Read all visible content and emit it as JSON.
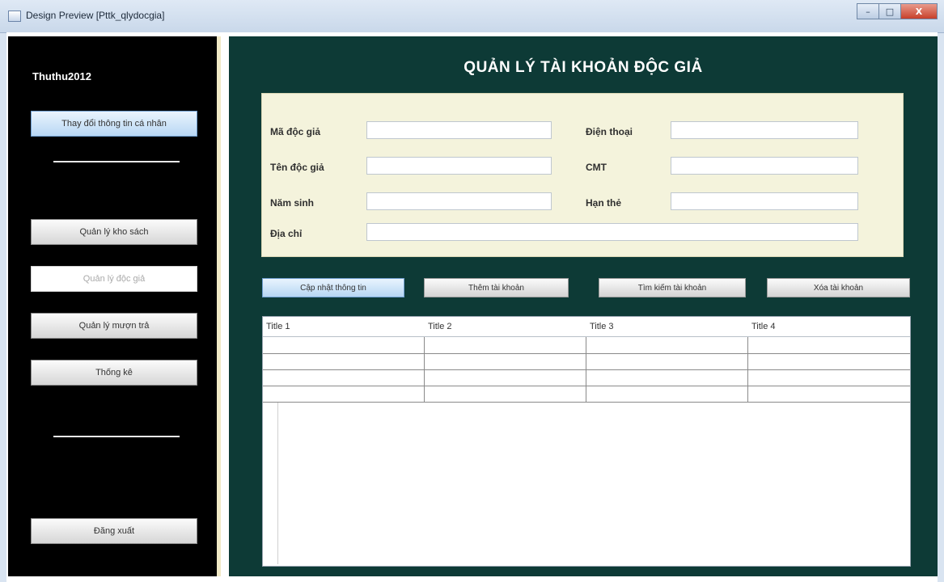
{
  "window": {
    "title": "Design Preview [Pttk_qlydocgia]",
    "minimize": "–",
    "maximize": "□",
    "close": "X"
  },
  "sidebar": {
    "username": "Thuthu2012",
    "change_info": "Thay đổi thông tin cá nhân",
    "menu": {
      "manage_books": "Quản lý kho sách",
      "manage_readers": "Quản lý độc giả",
      "manage_loans": "Quản lý mượn trả",
      "statistics": "Thống kê"
    },
    "logout": "Đăng xuất"
  },
  "main": {
    "title": "QUẢN LÝ TÀI KHOẢN ĐỘC GIẢ",
    "form": {
      "reader_id": {
        "label": "Mã độc giả",
        "value": ""
      },
      "phone": {
        "label": "Điện thoại",
        "value": ""
      },
      "reader_name": {
        "label": "Tên độc giả",
        "value": ""
      },
      "id_card": {
        "label": "CMT",
        "value": ""
      },
      "birth_year": {
        "label": "Năm sinh",
        "value": ""
      },
      "card_expiry": {
        "label": "Hạn thẻ",
        "value": ""
      },
      "address": {
        "label": "Địa chỉ",
        "value": ""
      }
    },
    "actions": {
      "update": "Cập nhật thông tin",
      "add": "Thêm tài khoản",
      "search": "Tìm kiếm tài khoản",
      "delete": "Xóa tài khoản"
    },
    "table": {
      "columns": [
        "Title 1",
        "Title 2",
        "Title 3",
        "Title 4"
      ],
      "rows": [
        [
          "",
          "",
          "",
          ""
        ],
        [
          "",
          "",
          "",
          ""
        ],
        [
          "",
          "",
          "",
          ""
        ],
        [
          "",
          "",
          "",
          ""
        ]
      ]
    }
  }
}
